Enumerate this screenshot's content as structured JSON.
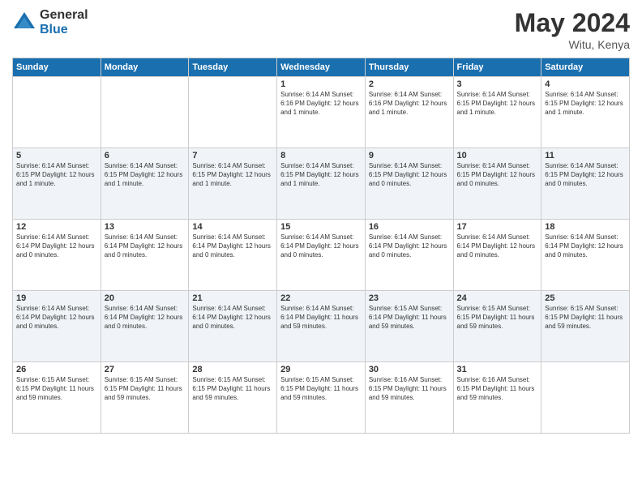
{
  "logo": {
    "general": "General",
    "blue": "Blue"
  },
  "title": {
    "month_year": "May 2024",
    "location": "Witu, Kenya"
  },
  "days_of_week": [
    "Sunday",
    "Monday",
    "Tuesday",
    "Wednesday",
    "Thursday",
    "Friday",
    "Saturday"
  ],
  "weeks": [
    [
      {
        "day": "",
        "info": ""
      },
      {
        "day": "",
        "info": ""
      },
      {
        "day": "",
        "info": ""
      },
      {
        "day": "1",
        "info": "Sunrise: 6:14 AM\nSunset: 6:16 PM\nDaylight: 12 hours\nand 1 minute."
      },
      {
        "day": "2",
        "info": "Sunrise: 6:14 AM\nSunset: 6:16 PM\nDaylight: 12 hours\nand 1 minute."
      },
      {
        "day": "3",
        "info": "Sunrise: 6:14 AM\nSunset: 6:15 PM\nDaylight: 12 hours\nand 1 minute."
      },
      {
        "day": "4",
        "info": "Sunrise: 6:14 AM\nSunset: 6:15 PM\nDaylight: 12 hours\nand 1 minute."
      }
    ],
    [
      {
        "day": "5",
        "info": "Sunrise: 6:14 AM\nSunset: 6:15 PM\nDaylight: 12 hours\nand 1 minute."
      },
      {
        "day": "6",
        "info": "Sunrise: 6:14 AM\nSunset: 6:15 PM\nDaylight: 12 hours\nand 1 minute."
      },
      {
        "day": "7",
        "info": "Sunrise: 6:14 AM\nSunset: 6:15 PM\nDaylight: 12 hours\nand 1 minute."
      },
      {
        "day": "8",
        "info": "Sunrise: 6:14 AM\nSunset: 6:15 PM\nDaylight: 12 hours\nand 1 minute."
      },
      {
        "day": "9",
        "info": "Sunrise: 6:14 AM\nSunset: 6:15 PM\nDaylight: 12 hours\nand 0 minutes."
      },
      {
        "day": "10",
        "info": "Sunrise: 6:14 AM\nSunset: 6:15 PM\nDaylight: 12 hours\nand 0 minutes."
      },
      {
        "day": "11",
        "info": "Sunrise: 6:14 AM\nSunset: 6:15 PM\nDaylight: 12 hours\nand 0 minutes."
      }
    ],
    [
      {
        "day": "12",
        "info": "Sunrise: 6:14 AM\nSunset: 6:14 PM\nDaylight: 12 hours\nand 0 minutes."
      },
      {
        "day": "13",
        "info": "Sunrise: 6:14 AM\nSunset: 6:14 PM\nDaylight: 12 hours\nand 0 minutes."
      },
      {
        "day": "14",
        "info": "Sunrise: 6:14 AM\nSunset: 6:14 PM\nDaylight: 12 hours\nand 0 minutes."
      },
      {
        "day": "15",
        "info": "Sunrise: 6:14 AM\nSunset: 6:14 PM\nDaylight: 12 hours\nand 0 minutes."
      },
      {
        "day": "16",
        "info": "Sunrise: 6:14 AM\nSunset: 6:14 PM\nDaylight: 12 hours\nand 0 minutes."
      },
      {
        "day": "17",
        "info": "Sunrise: 6:14 AM\nSunset: 6:14 PM\nDaylight: 12 hours\nand 0 minutes."
      },
      {
        "day": "18",
        "info": "Sunrise: 6:14 AM\nSunset: 6:14 PM\nDaylight: 12 hours\nand 0 minutes."
      }
    ],
    [
      {
        "day": "19",
        "info": "Sunrise: 6:14 AM\nSunset: 6:14 PM\nDaylight: 12 hours\nand 0 minutes."
      },
      {
        "day": "20",
        "info": "Sunrise: 6:14 AM\nSunset: 6:14 PM\nDaylight: 12 hours\nand 0 minutes."
      },
      {
        "day": "21",
        "info": "Sunrise: 6:14 AM\nSunset: 6:14 PM\nDaylight: 12 hours\nand 0 minutes."
      },
      {
        "day": "22",
        "info": "Sunrise: 6:14 AM\nSunset: 6:14 PM\nDaylight: 11 hours\nand 59 minutes."
      },
      {
        "day": "23",
        "info": "Sunrise: 6:15 AM\nSunset: 6:14 PM\nDaylight: 11 hours\nand 59 minutes."
      },
      {
        "day": "24",
        "info": "Sunrise: 6:15 AM\nSunset: 6:15 PM\nDaylight: 11 hours\nand 59 minutes."
      },
      {
        "day": "25",
        "info": "Sunrise: 6:15 AM\nSunset: 6:15 PM\nDaylight: 11 hours\nand 59 minutes."
      }
    ],
    [
      {
        "day": "26",
        "info": "Sunrise: 6:15 AM\nSunset: 6:15 PM\nDaylight: 11 hours\nand 59 minutes."
      },
      {
        "day": "27",
        "info": "Sunrise: 6:15 AM\nSunset: 6:15 PM\nDaylight: 11 hours\nand 59 minutes."
      },
      {
        "day": "28",
        "info": "Sunrise: 6:15 AM\nSunset: 6:15 PM\nDaylight: 11 hours\nand 59 minutes."
      },
      {
        "day": "29",
        "info": "Sunrise: 6:15 AM\nSunset: 6:15 PM\nDaylight: 11 hours\nand 59 minutes."
      },
      {
        "day": "30",
        "info": "Sunrise: 6:16 AM\nSunset: 6:15 PM\nDaylight: 11 hours\nand 59 minutes."
      },
      {
        "day": "31",
        "info": "Sunrise: 6:16 AM\nSunset: 6:15 PM\nDaylight: 11 hours\nand 59 minutes."
      },
      {
        "day": "",
        "info": ""
      }
    ]
  ]
}
